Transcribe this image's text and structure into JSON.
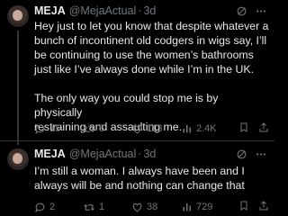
{
  "tweets": [
    {
      "name": "MEJA",
      "handle": "@MejaActual",
      "separator": "·",
      "time": "3d",
      "text_lines": [
        "Hey just to let you know that despite whatever a",
        "bunch of incontinent old codgers in wigs say, I’ll",
        "be continuing to use the women’s bathrooms",
        "just like I’ve always done while I’m in the UK."
      ],
      "text_lines_2": [
        "The only way you could stop me is by physically",
        "restraining and assaulting me."
      ],
      "replies": "15",
      "retweets": "5",
      "likes": "113",
      "views": "2.4K"
    },
    {
      "name": "MEJA",
      "handle": "@MejaActual",
      "separator": "·",
      "time": "3d",
      "text_lines": [
        "I’m still a woman. I always have been and I",
        "always will be and nothing can change that"
      ],
      "replies": "2",
      "retweets": "1",
      "likes": "38",
      "views": "729"
    }
  ],
  "icons": {
    "header": [
      "grok-icon",
      "more-icon"
    ],
    "actions": [
      "reply-icon",
      "retweet-icon",
      "like-icon",
      "views-icon",
      "bookmark-icon",
      "share-icon"
    ]
  },
  "colors": {
    "background": "#000000",
    "text": "#e7e9ea",
    "muted": "#71767b",
    "divider": "#2f3336"
  }
}
